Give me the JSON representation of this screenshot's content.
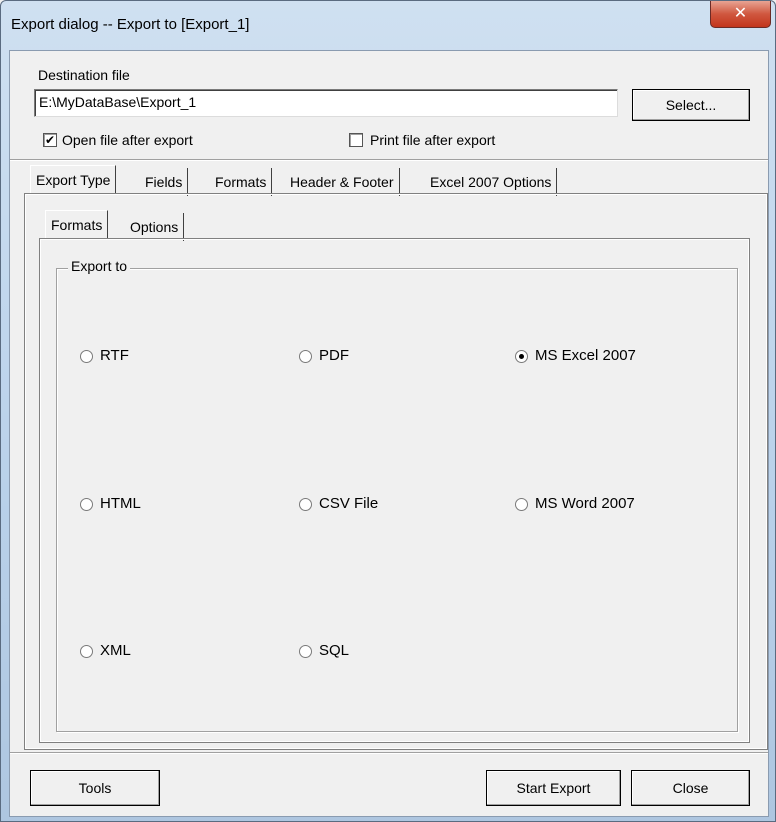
{
  "window": {
    "title": "Export dialog -- Export to [Export_1]",
    "close_symbol": "✕"
  },
  "destination": {
    "label": "Destination file",
    "value": "E:\\MyDataBase\\Export_1",
    "select_label": "Select...",
    "open_after_label": "Open file after export",
    "open_after_checked": true,
    "print_after_label": "Print file after export",
    "print_after_checked": false
  },
  "tabs": [
    "Export Type",
    "Fields",
    "Formats",
    "Header & Footer",
    "Excel 2007 Options"
  ],
  "active_tab": "Export Type",
  "subtabs": [
    "Formats",
    "Options"
  ],
  "active_subtab": "Formats",
  "export_to": {
    "group_label": "Export to",
    "options": [
      "RTF",
      "PDF",
      "MS Excel 2007",
      "HTML",
      "CSV File",
      "MS Word 2007",
      "XML",
      "SQL"
    ],
    "selected": "MS Excel 2007"
  },
  "footer": {
    "tools_label": "Tools",
    "start_label": "Start Export",
    "close_label": "Close"
  },
  "check_mark": "✔"
}
